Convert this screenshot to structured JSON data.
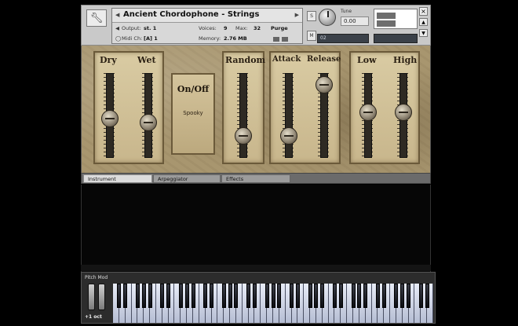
{
  "header": {
    "title": "Ancient Chordophone - Strings",
    "output_label": "Output:",
    "output_value": "st. 1",
    "voices_label": "Voices:",
    "voices_value": "9",
    "max_label": "Max:",
    "max_value": "32",
    "purge_label": "Purge",
    "midi_label": "Midi Ch:",
    "midi_value": "[A] 1",
    "memory_label": "Memory:",
    "memory_value": "2.76 MB",
    "tune_label": "Tune",
    "tune_value": "0.00",
    "aux_value": "02",
    "s_button": "S",
    "m_button": "M",
    "close": "×"
  },
  "panels": {
    "dry_wet": {
      "dry": "Dry",
      "wet": "Wet"
    },
    "onoff": {
      "title": "On/Off",
      "sub": "Spooky"
    },
    "random": {
      "label": "Random"
    },
    "attack_release": {
      "attack": "Attack",
      "release": "Release"
    },
    "low_high": {
      "low": "Low",
      "high": "High"
    }
  },
  "sliders": {
    "dry": 0.45,
    "wet": 0.4,
    "random": 0.2,
    "attack": 0.2,
    "release": 0.95,
    "low": 0.55,
    "high": 0.55
  },
  "tabs": [
    "Instrument",
    "Arpeggiator",
    "Effects"
  ],
  "keyboard": {
    "pitch_mod": "Pitch  Mod",
    "octave": "+1 oct"
  }
}
